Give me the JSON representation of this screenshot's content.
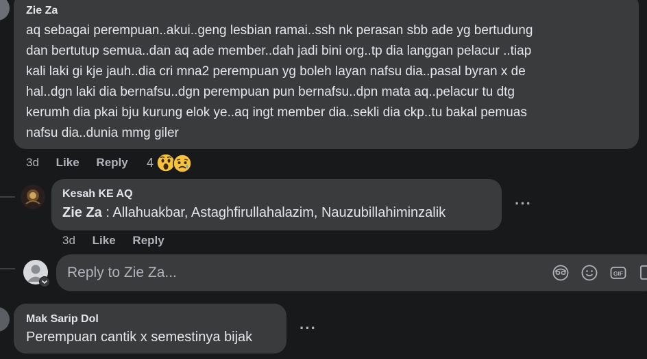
{
  "comments": [
    {
      "author": "Zie Za",
      "text_lines": [
        "aq sebagai perempuan..akui..geng lesbian ramai..ssh nk perasan sbb ade yg bertudung",
        "dan bertutup semua..dan aq ade member..dah jadi bini org..tp dia langgan pelacur ..tiap",
        "kali laki gi kje jauh..dia cri mna2 perempuan yg boleh layan nafsu dia..pasal byran x de",
        "hal..dgn laki dia bernafsu..dgn perempuan pun bernafsu..dpn mata aq..pelacur tu dtg",
        "kerumh dia pkai bju kurung elok ye..aq ingt member dia..sekli dia ckp..tu bakal pemuas",
        "nafsu dia..dunia mmg giler"
      ],
      "time": "3d",
      "like_label": "Like",
      "reply_label": "Reply",
      "reaction_count": "4"
    },
    {
      "author": "Kesah KE AQ",
      "mention": "Zie Za",
      "text": " : Allahuakbar, Astaghfirullahalazim, Nauzubillahiminzalik",
      "time": "3d",
      "like_label": "Like",
      "reply_label": "Reply",
      "more_label": "···"
    },
    {
      "author": "Mak Sarip Dol",
      "text": "Perempuan cantik x semestinya bijak",
      "more_label": "···"
    }
  ],
  "reply_box": {
    "placeholder": "Reply to Zie Za..."
  },
  "icons": [
    "avatar-icon",
    "wow-reaction-icon",
    "sad-reaction-icon",
    "avatar-sticker-icon",
    "emoji-icon",
    "gif-icon",
    "sticker-icon"
  ],
  "colors": {
    "background": "#18191a",
    "bubble": "#3a3b3c",
    "text": "#e4e6eb",
    "secondary_text": "#b0b3b8"
  }
}
